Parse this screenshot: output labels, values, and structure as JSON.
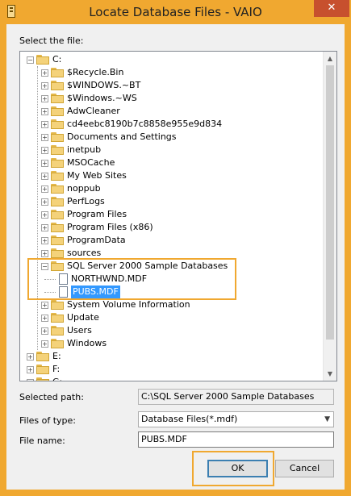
{
  "window": {
    "title": "Locate Database Files - VAIO",
    "close_glyph": "✕"
  },
  "select_label": "Select the file:",
  "tree": {
    "nodes": [
      {
        "label": "C:",
        "depth": 0,
        "kind": "folder",
        "expander": "−"
      },
      {
        "label": "$Recycle.Bin",
        "depth": 1,
        "kind": "folder",
        "expander": "+"
      },
      {
        "label": "$WINDOWS.~BT",
        "depth": 1,
        "kind": "folder",
        "expander": "+"
      },
      {
        "label": "$Windows.~WS",
        "depth": 1,
        "kind": "folder",
        "expander": "+"
      },
      {
        "label": "AdwCleaner",
        "depth": 1,
        "kind": "folder",
        "expander": "+"
      },
      {
        "label": "cd4eebc8190b7c8858e955e9d834",
        "depth": 1,
        "kind": "folder",
        "expander": "+"
      },
      {
        "label": "Documents and Settings",
        "depth": 1,
        "kind": "folder",
        "expander": "+"
      },
      {
        "label": "inetpub",
        "depth": 1,
        "kind": "folder",
        "expander": "+"
      },
      {
        "label": "MSOCache",
        "depth": 1,
        "kind": "folder",
        "expander": "+"
      },
      {
        "label": "My Web Sites",
        "depth": 1,
        "kind": "folder",
        "expander": "+"
      },
      {
        "label": "noppub",
        "depth": 1,
        "kind": "folder",
        "expander": "+"
      },
      {
        "label": "PerfLogs",
        "depth": 1,
        "kind": "folder",
        "expander": "+"
      },
      {
        "label": "Program Files",
        "depth": 1,
        "kind": "folder",
        "expander": "+"
      },
      {
        "label": "Program Files (x86)",
        "depth": 1,
        "kind": "folder",
        "expander": "+"
      },
      {
        "label": "ProgramData",
        "depth": 1,
        "kind": "folder",
        "expander": "+"
      },
      {
        "label": "sources",
        "depth": 1,
        "kind": "folder",
        "expander": "+"
      },
      {
        "label": "SQL Server 2000 Sample Databases",
        "depth": 1,
        "kind": "folder",
        "expander": "−"
      },
      {
        "label": "NORTHWND.MDF",
        "depth": 2,
        "kind": "file",
        "expander": ""
      },
      {
        "label": "PUBS.MDF",
        "depth": 2,
        "kind": "file",
        "expander": "",
        "selected": true
      },
      {
        "label": "System Volume Information",
        "depth": 1,
        "kind": "folder",
        "expander": "+"
      },
      {
        "label": "Update",
        "depth": 1,
        "kind": "folder",
        "expander": "+"
      },
      {
        "label": "Users",
        "depth": 1,
        "kind": "folder",
        "expander": "+"
      },
      {
        "label": "Windows",
        "depth": 1,
        "kind": "folder",
        "expander": "+"
      },
      {
        "label": "E:",
        "depth": 0,
        "kind": "folder",
        "expander": "+"
      },
      {
        "label": "F:",
        "depth": 0,
        "kind": "folder",
        "expander": "+"
      },
      {
        "label": "G:",
        "depth": 0,
        "kind": "folder",
        "expander": "+"
      }
    ]
  },
  "form": {
    "selected_path_label": "Selected path:",
    "selected_path_value": "C:\\SQL Server 2000 Sample Databases",
    "files_of_type_label": "Files of type:",
    "files_of_type_value": "Database Files(*.mdf)",
    "file_name_label": "File name:",
    "file_name_value": "PUBS.MDF"
  },
  "buttons": {
    "ok": "OK",
    "cancel": "Cancel"
  },
  "colors": {
    "accent": "#f0a830",
    "selection": "#3399ff",
    "close": "#c7502e"
  },
  "icons": {
    "app": "database-icon",
    "folder": "folder-icon",
    "file": "file-icon"
  }
}
